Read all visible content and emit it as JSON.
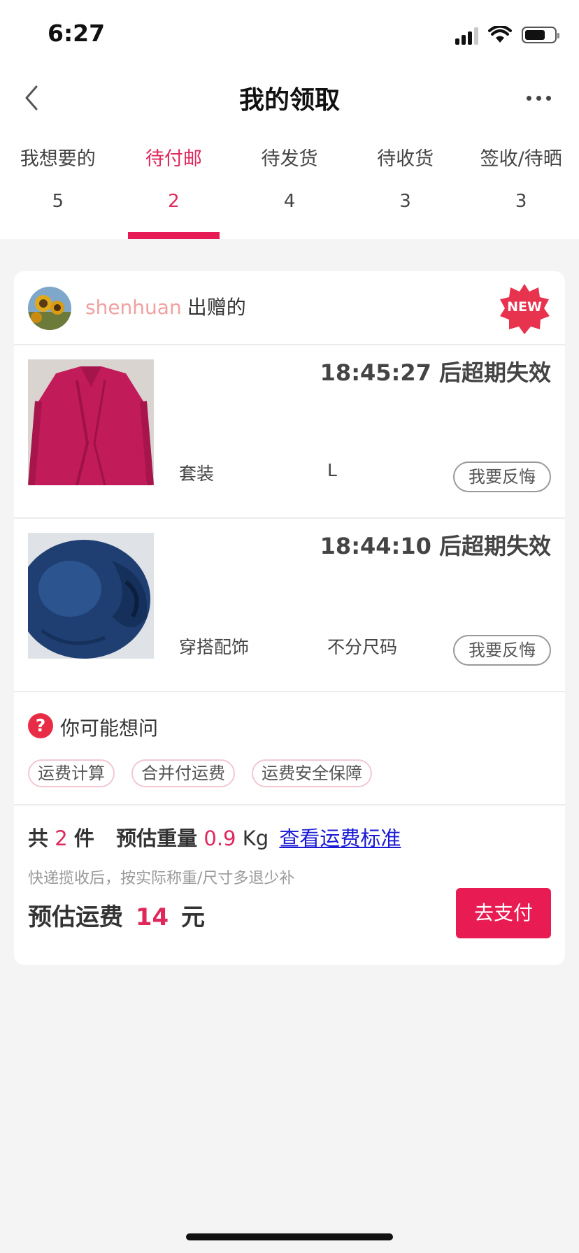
{
  "status_bar": {
    "time": "6:27"
  },
  "nav": {
    "title": "我的领取"
  },
  "tabs": [
    {
      "label": "我想要的",
      "count": "5"
    },
    {
      "label": "待付邮",
      "count": "2",
      "active": true
    },
    {
      "label": "待发货",
      "count": "4"
    },
    {
      "label": "待收货",
      "count": "3"
    },
    {
      "label": "签收/待晒",
      "count": "3"
    }
  ],
  "giver": {
    "username": "shenhuan",
    "suffix": "出赠的",
    "badge": "NEW"
  },
  "items": [
    {
      "timer": "18:45:27 后超期失效",
      "category": "套装",
      "size": "L",
      "regret_label": "我要反悔"
    },
    {
      "timer": "18:44:10 后超期失效",
      "category": "穿搭配饰",
      "size": "不分尺码",
      "regret_label": "我要反悔"
    }
  ],
  "faq": {
    "icon": "question-icon",
    "icon_glyph": "?",
    "title": "你可能想问",
    "chips": [
      "运费计算",
      "合并付运费",
      "运费安全保障"
    ]
  },
  "summary": {
    "total_prefix": "共",
    "total_count": "2",
    "total_unit": "件",
    "weight_label": "预估重量",
    "weight_value": "0.9",
    "weight_unit": "Kg",
    "link": "查看运费标准",
    "note": "快递揽收后，按实际称重/尺寸多退少补",
    "fee_label": "预估运费",
    "fee_value": "14",
    "fee_unit": "元",
    "pay_label": "去支付"
  },
  "colors": {
    "accent": "#e81b52",
    "link": "#1a1ad6",
    "username": "#f0a0a0"
  }
}
